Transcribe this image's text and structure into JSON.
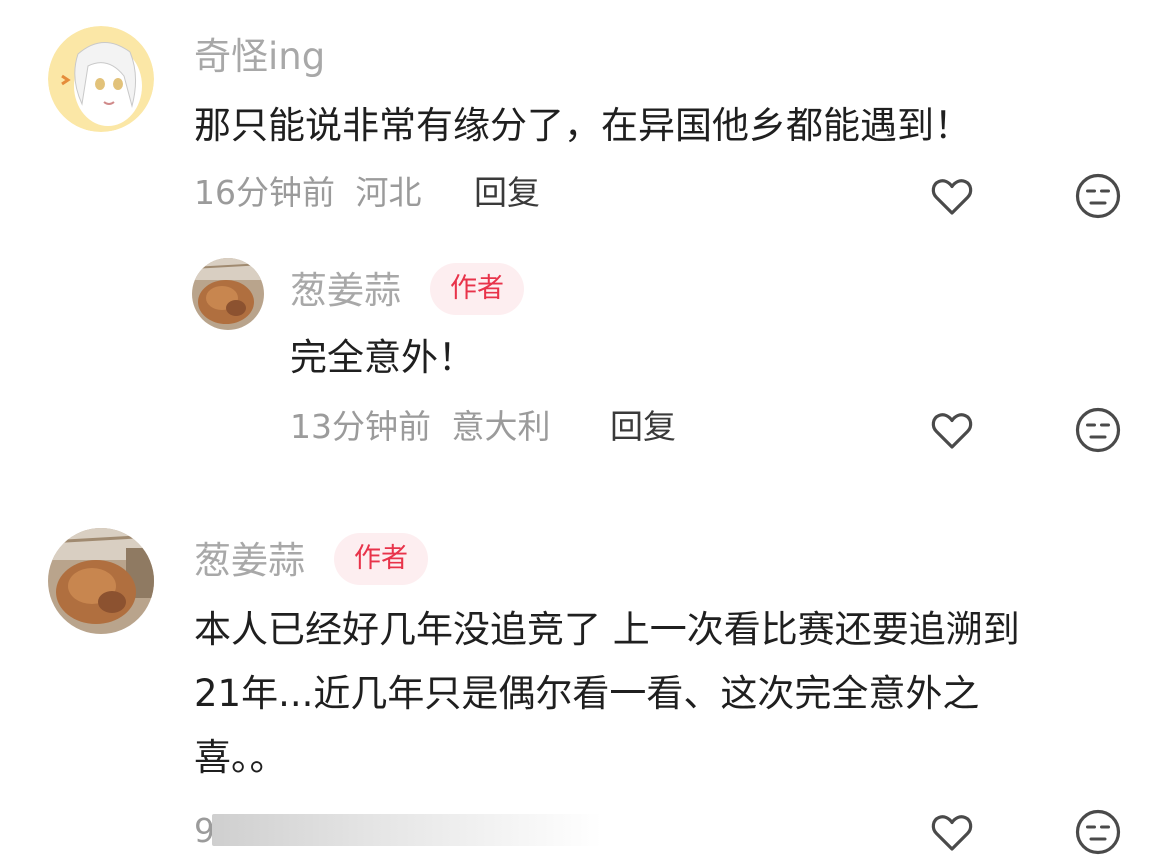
{
  "comments": [
    {
      "username": "奇怪ing",
      "text_lines": [
        "那只能说非常有缘分了，在异国他乡都能遇到！"
      ],
      "time": "16分钟前",
      "location": "河北",
      "reply_label": "回复",
      "is_author": false
    },
    {
      "username": "葱姜蒜",
      "author_badge": "作者",
      "text_lines": [
        "完全意外！"
      ],
      "time": "13分钟前",
      "location": "意大利",
      "reply_label": "回复",
      "is_author": true
    },
    {
      "username": "葱姜蒜",
      "author_badge": "作者",
      "text_lines": [
        "本人已经好几年没追竞了 上一次看比赛还要追溯到",
        "21年...近几年只是偶尔看一看、这次完全意外之",
        "喜。。"
      ],
      "time_partial": "9",
      "is_author": true
    }
  ],
  "icons": {
    "like": "heart-outline-icon",
    "dislike": "expressionless-face-icon"
  },
  "colors": {
    "username": "#a8a8a8",
    "meta": "#9b9b9b",
    "badge_bg": "#fdeef0",
    "badge_text": "#e8334a",
    "body_text": "#1f1f1f"
  }
}
